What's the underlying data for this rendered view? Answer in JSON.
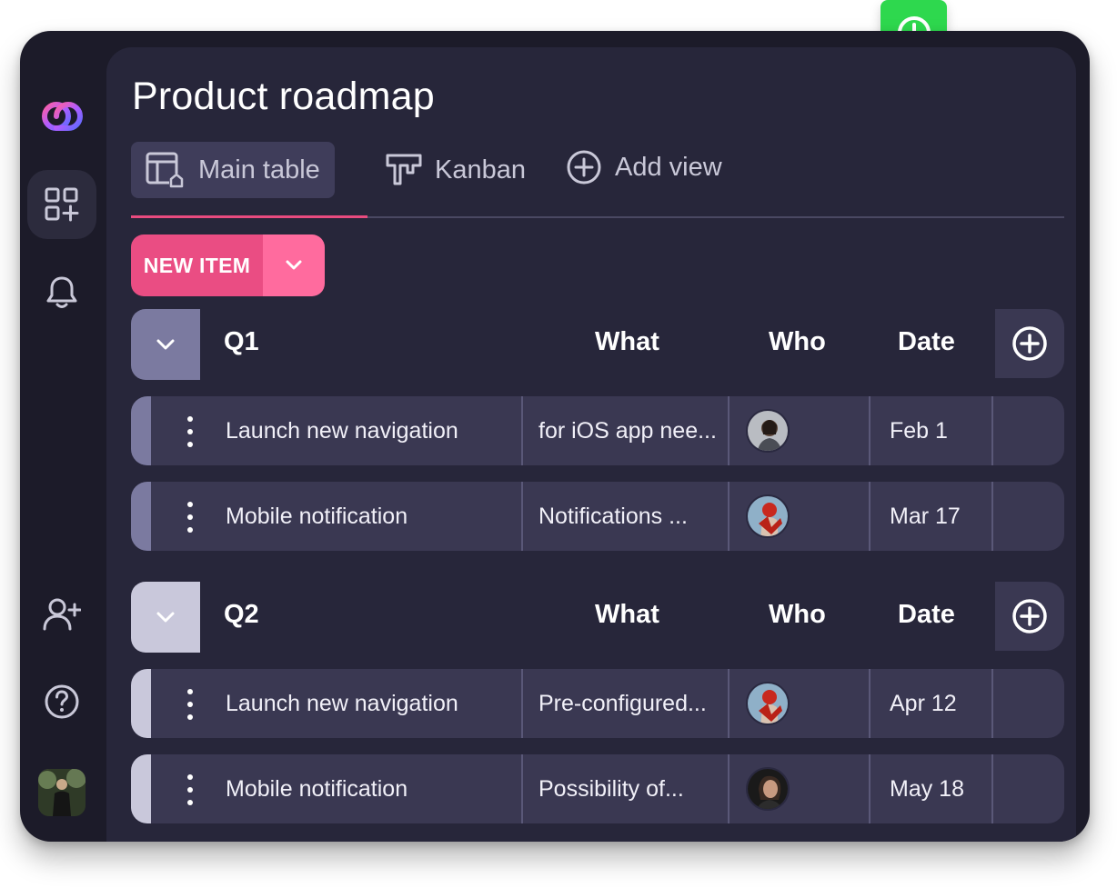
{
  "app": {
    "title": "Product roadmap"
  },
  "tabs": [
    {
      "label": "Main table",
      "icon": "table-home-icon",
      "active": true
    },
    {
      "label": "Kanban",
      "icon": "kanban-icon",
      "active": false
    },
    {
      "label": "Add view",
      "icon": "add-circle-icon",
      "active": false
    }
  ],
  "sidebar": {
    "items": [
      {
        "icon": "app-logo"
      },
      {
        "icon": "add-widget-icon",
        "active": true
      },
      {
        "icon": "bell-icon"
      },
      {
        "icon": "add-user-icon"
      },
      {
        "icon": "help-icon"
      },
      {
        "icon": "user-avatar"
      }
    ]
  },
  "toolbar": {
    "new_item_label": "NEW ITEM"
  },
  "columns": {
    "what": "What",
    "who": "Who",
    "date": "Date"
  },
  "groups": [
    {
      "title": "Q1",
      "color": "#7b7aa0",
      "rows": [
        {
          "name": "Launch new navigation",
          "what": "for iOS app nee...",
          "who": "person-1",
          "date": "Feb 1"
        },
        {
          "name": "Mobile notification",
          "what": "Notifications ...",
          "who": "person-2",
          "date": "Mar 17"
        }
      ]
    },
    {
      "title": "Q2",
      "color": "#c9c8db",
      "rows": [
        {
          "name": "Launch new navigation",
          "what": "Pre-configured...",
          "who": "person-2",
          "date": "Apr 12"
        },
        {
          "name": "Mobile notification",
          "what": "Possibility of...",
          "who": "person-3",
          "date": "May 18"
        }
      ]
    }
  ],
  "colors": {
    "accent_pink": "#ea4d83",
    "fab_green": "#2ed84e",
    "panel": "#27263a",
    "frame": "#1c1b29"
  }
}
